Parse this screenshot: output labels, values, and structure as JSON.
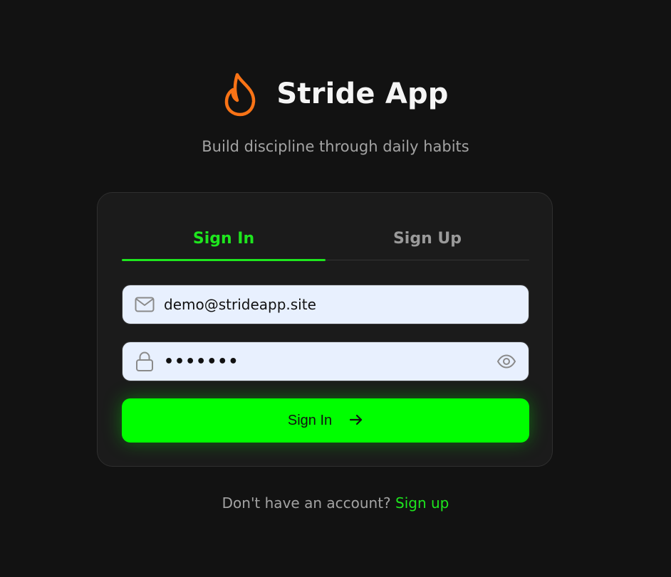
{
  "brand": {
    "title": "Stride App",
    "icon": "flame-icon",
    "icon_color": "#f97316"
  },
  "tagline": "Build discipline through daily habits",
  "tabs": [
    {
      "label": "Sign In",
      "active": true
    },
    {
      "label": "Sign Up",
      "active": false
    }
  ],
  "form": {
    "email": {
      "value": "demo@strideapp.site",
      "icon": "mail-icon"
    },
    "password": {
      "value": "•••••••",
      "icon": "lock-icon",
      "toggle_icon": "eye-icon"
    },
    "submit_label": "Sign In"
  },
  "footer": {
    "prompt": "Don't have an account?",
    "link": "Sign up"
  },
  "colors": {
    "accent": "#00ff00",
    "background": "#121212",
    "card": "#1b1b1b"
  }
}
